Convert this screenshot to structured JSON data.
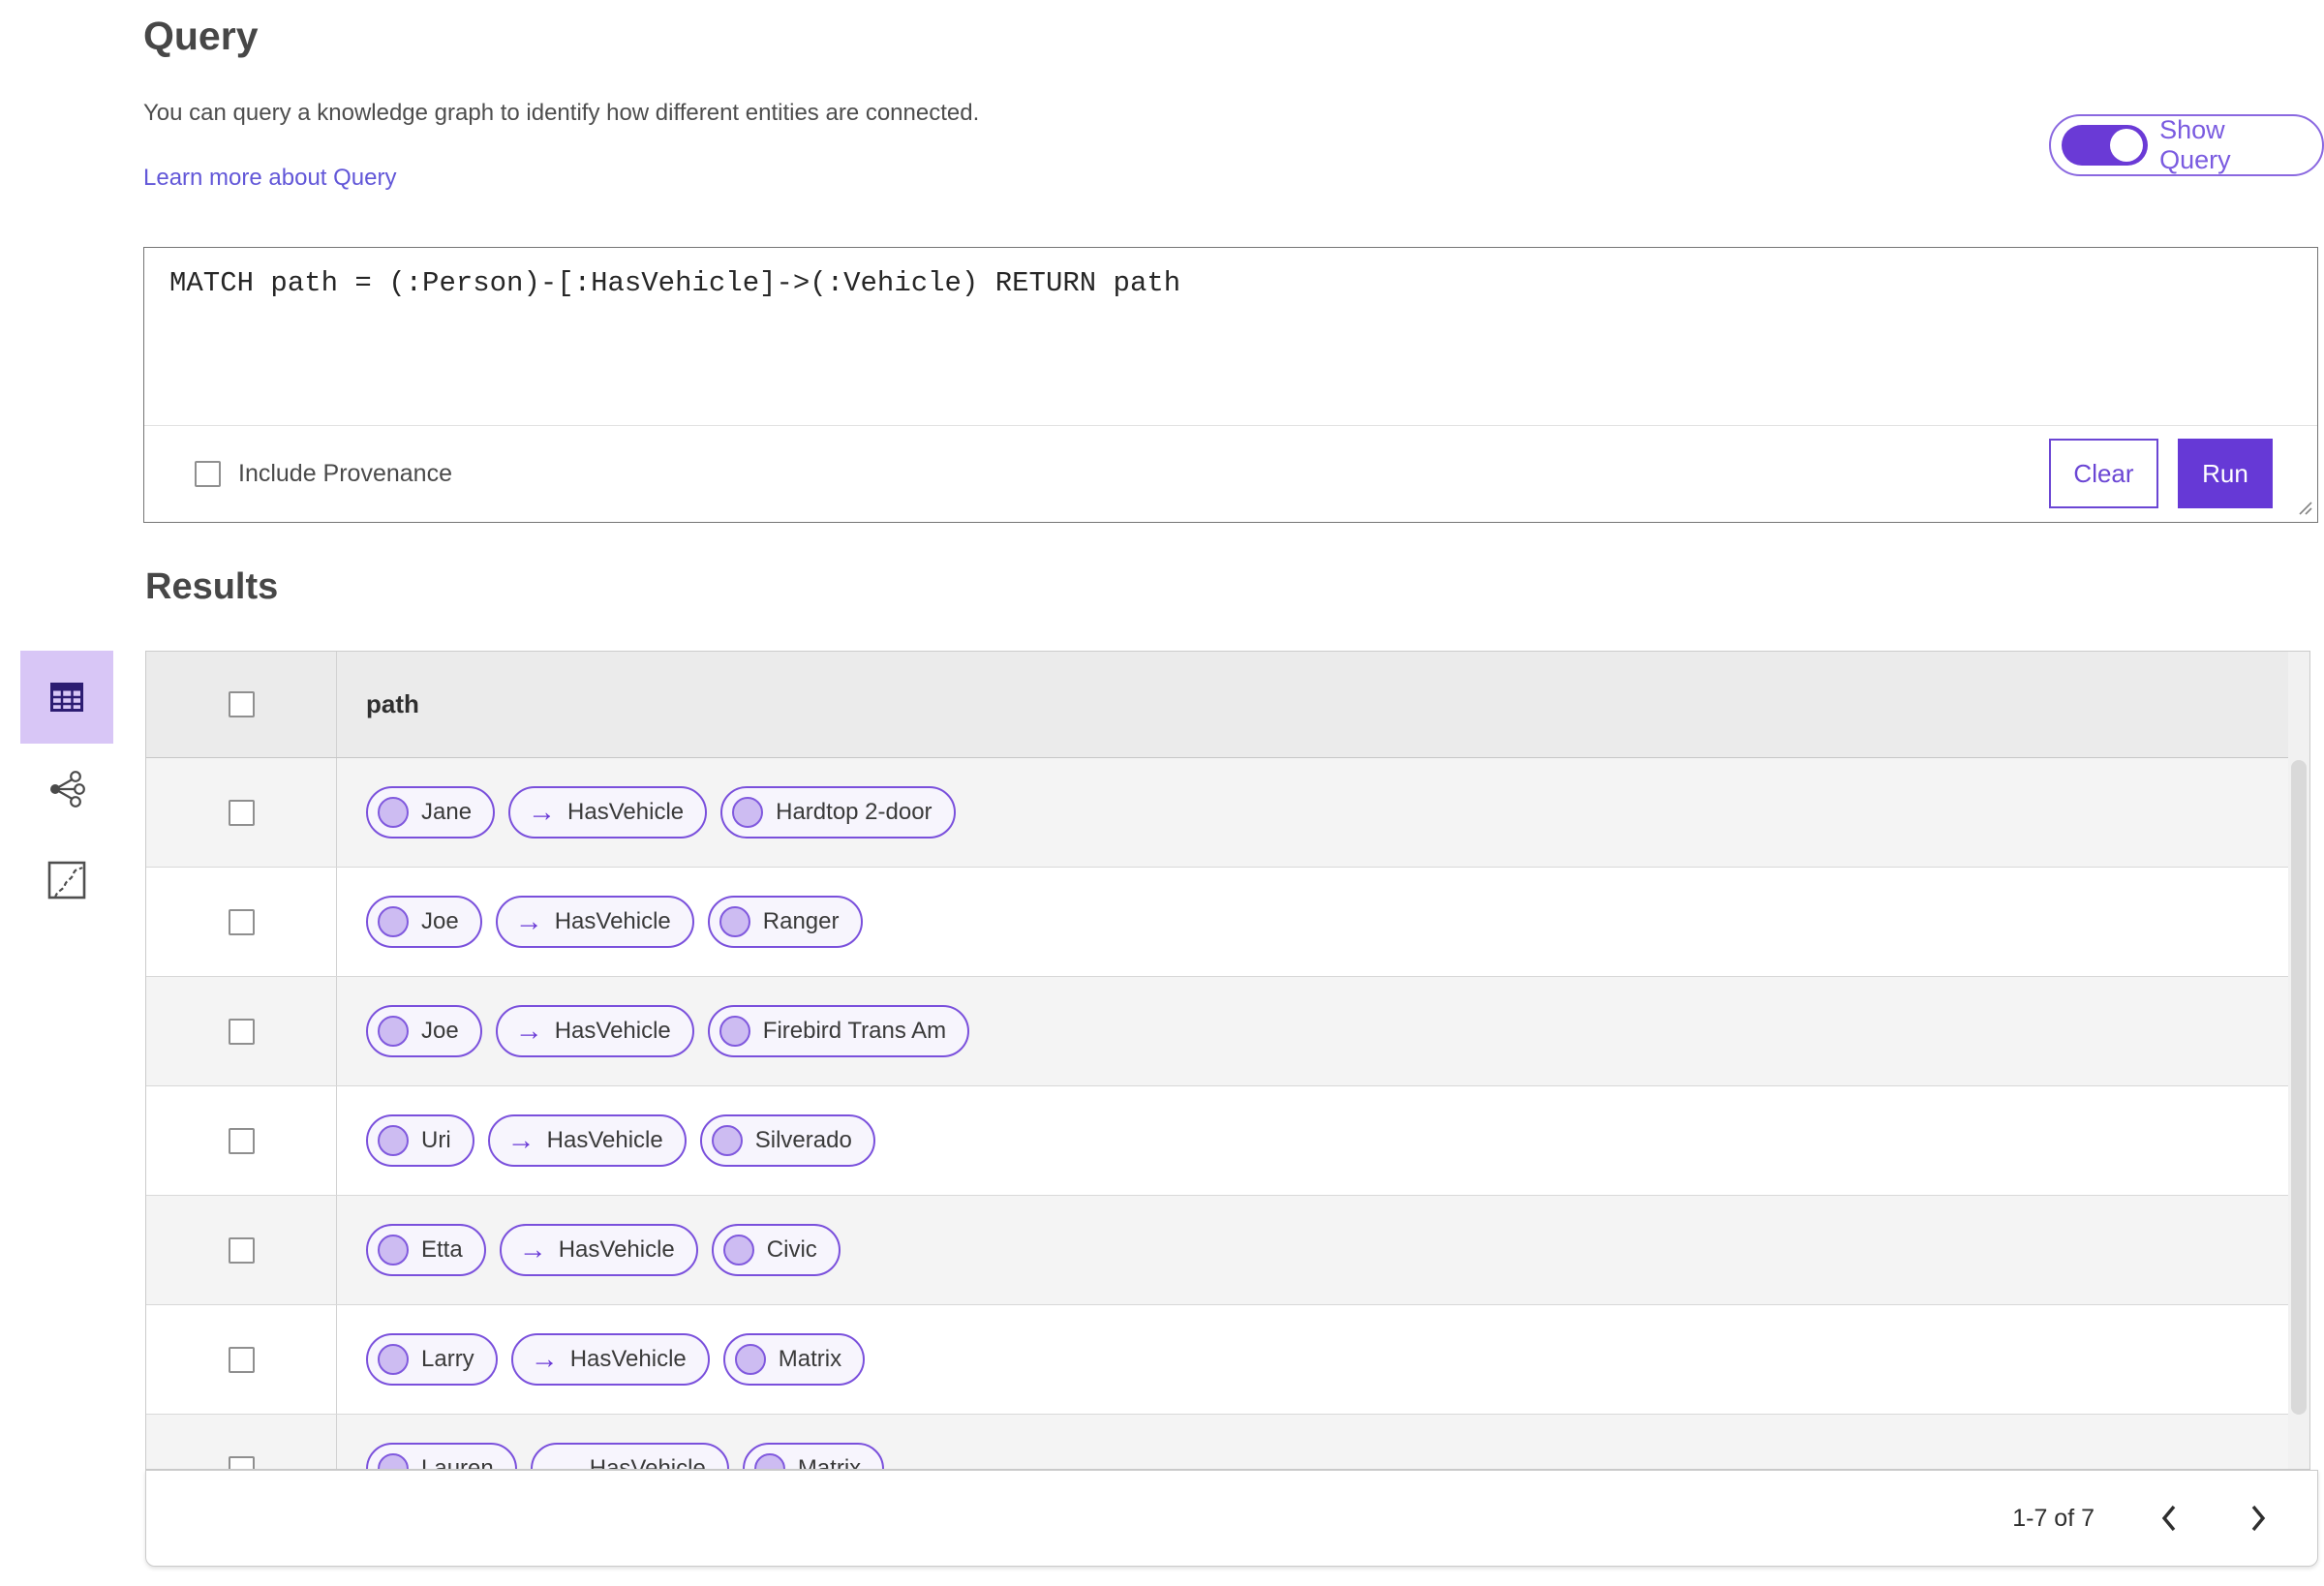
{
  "header": {
    "title": "Query",
    "description": "You can query a knowledge graph to identify how different entities are connected.",
    "learn_more_label": "Learn more about Query",
    "show_query_label": "Show Query",
    "show_query_on": true
  },
  "query_editor": {
    "query_text": "MATCH path = (:Person)-[:HasVehicle]->(:Vehicle) RETURN path",
    "include_provenance_label": "Include Provenance",
    "include_provenance_checked": false,
    "clear_label": "Clear",
    "run_label": "Run"
  },
  "results": {
    "title": "Results",
    "view_buttons": [
      "table-view",
      "link-chart-view",
      "map-view"
    ],
    "selected_view": "table-view",
    "table": {
      "columns": [
        "path"
      ],
      "rows": [
        {
          "source": "Jane",
          "relationship": "HasVehicle",
          "target": "Hardtop 2-door"
        },
        {
          "source": "Joe",
          "relationship": "HasVehicle",
          "target": "Ranger"
        },
        {
          "source": "Joe",
          "relationship": "HasVehicle",
          "target": "Firebird Trans Am"
        },
        {
          "source": "Uri",
          "relationship": "HasVehicle",
          "target": "Silverado"
        },
        {
          "source": "Etta",
          "relationship": "HasVehicle",
          "target": "Civic"
        },
        {
          "source": "Larry",
          "relationship": "HasVehicle",
          "target": "Matrix"
        },
        {
          "source": "Lauren",
          "relationship": "HasVehicle",
          "target": "Matrix"
        }
      ]
    },
    "pagination": {
      "range_label": "1-7 of 7"
    }
  },
  "icons": {
    "relationship_arrow": "→"
  },
  "colors": {
    "primary_purple": "#6639d6",
    "toggle_fill": "#6a3ad6",
    "chip_border": "#7a50dc",
    "chip_background": "#f7f5fd",
    "chip_circle_fill": "#cdbcf2",
    "link_text": "#6257d8",
    "selected_view_background": "#d8c6f6",
    "selected_view_icon": "#2c1c72",
    "header_row_background": "#ebebeb",
    "alt_row_background": "#f4f4f4"
  }
}
